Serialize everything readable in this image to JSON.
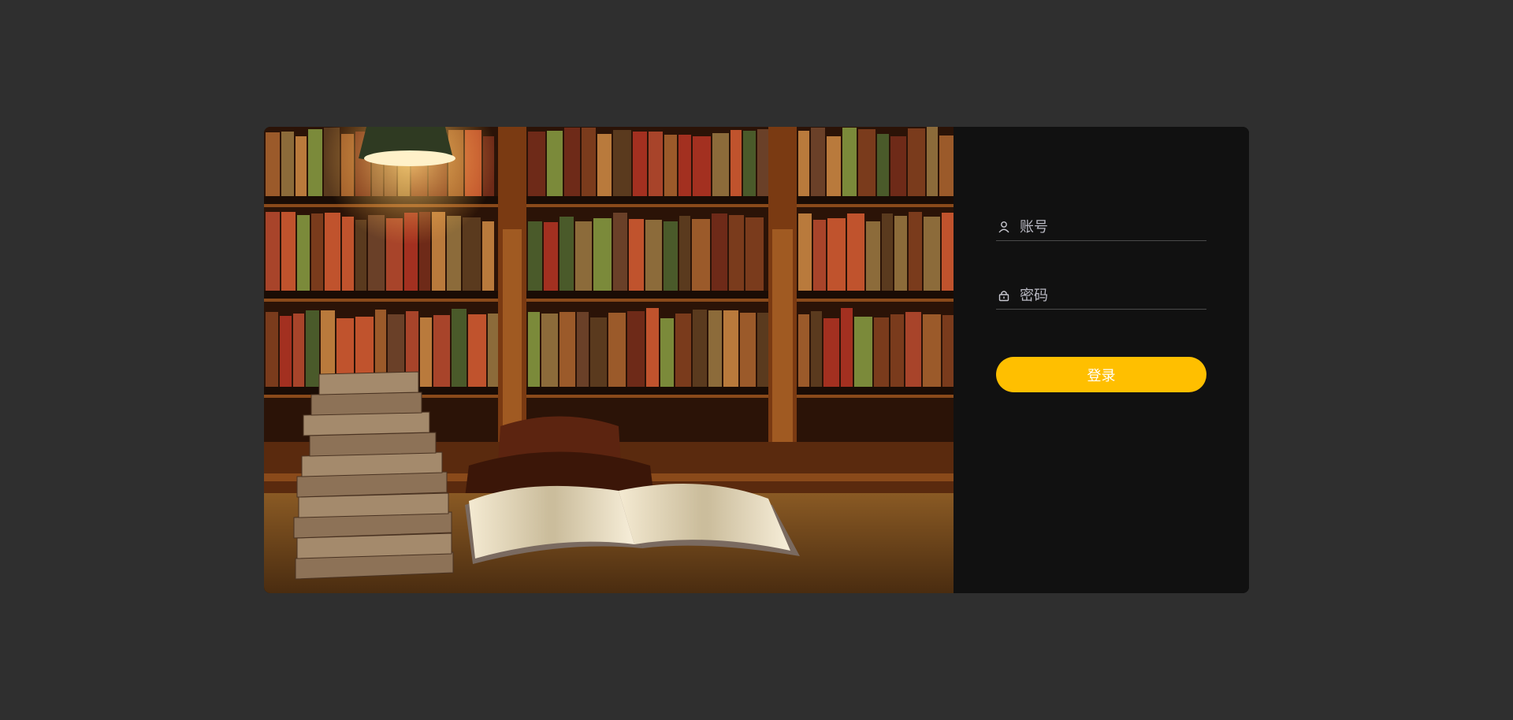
{
  "login": {
    "account_placeholder": "账号",
    "password_placeholder": "密码",
    "submit_label": "登录"
  },
  "colors": {
    "page_background": "#2f2f2f",
    "panel_background": "#111111",
    "accent": "#ffbf00"
  },
  "icons": {
    "account": "user-icon",
    "password": "lock-icon"
  }
}
